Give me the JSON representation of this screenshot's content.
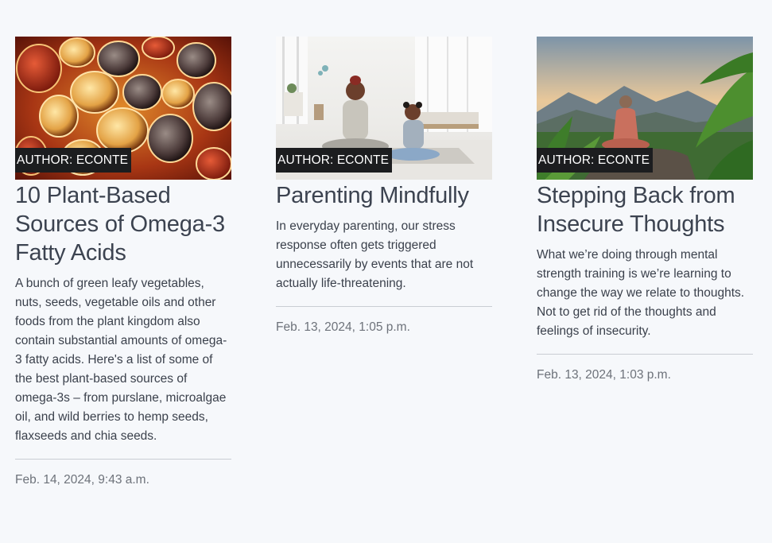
{
  "posts": [
    {
      "author": "AUTHOR: ECONTE",
      "title": "10 Plant-Based Sources of Omega-3 Fatty Acids",
      "excerpt": "A bunch of green leafy vegetables, nuts, seeds, vegetable oils and other foods from the plant kingdom also contain substantial amounts of omega-3 fatty acids. Here's a list of some of the best plant-based sources of omega-3s – from purslane, microalgae oil, and wild berries to hemp seeds, flaxseeds and chia seeds.",
      "date": "Feb. 14, 2024, 9:43 a.m."
    },
    {
      "author": "AUTHOR: ECONTE",
      "title": "Parenting Mindfully",
      "excerpt": "In everyday parenting, our stress response often gets triggered unnecessarily by events that are not actually life-threatening.",
      "date": "Feb. 13, 2024, 1:05 p.m."
    },
    {
      "author": "AUTHOR: ECONTE",
      "title": "Stepping Back from Insecure Thoughts",
      "excerpt": "What we’re doing through mental strength training is we’re learning to change the way we relate to thoughts. Not to get rid of the thoughts and feelings of insecurity.",
      "date": "Feb. 13, 2024, 1:03 p.m."
    }
  ]
}
